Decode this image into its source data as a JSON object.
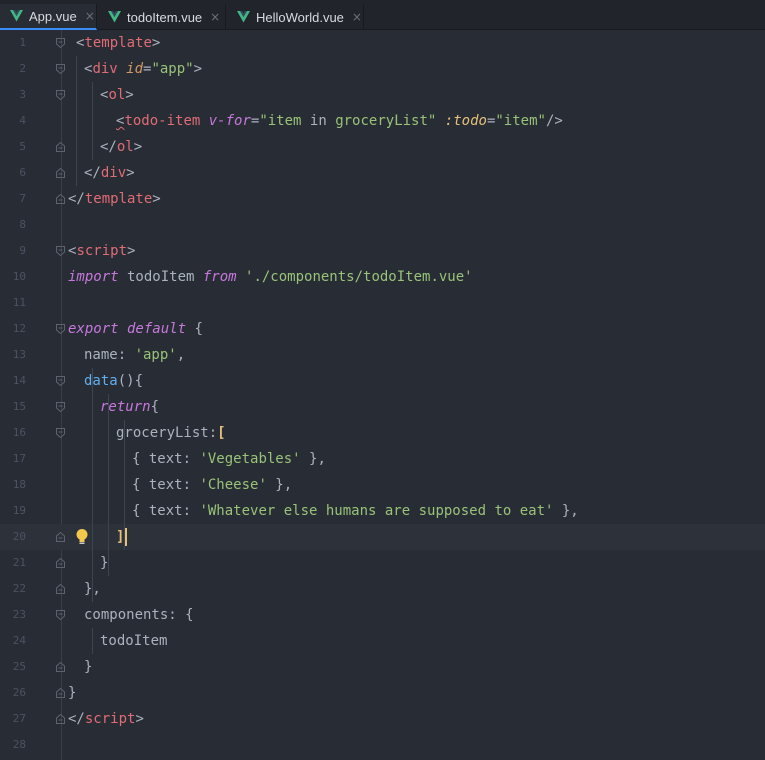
{
  "tabs": [
    {
      "label": "App.vue",
      "active": true
    },
    {
      "label": "todoItem.vue",
      "active": false
    },
    {
      "label": "HelloWorld.vue",
      "active": false
    }
  ],
  "close_glyph": "×",
  "colors": {
    "background": "#282c34",
    "tag": "#e06c75",
    "string": "#98c379",
    "keyword": "#c678dd",
    "attribute": "#d19a66",
    "accent": "#3a8df7",
    "vue_green": "#41b883"
  },
  "lines": [
    {
      "n": "1",
      "tokens": [
        [
          "t-punc",
          "<"
        ],
        [
          "t-tag",
          "template"
        ],
        [
          "t-punc",
          ">"
        ]
      ]
    },
    {
      "n": "2",
      "tokens": [
        [
          "t-punc",
          "<"
        ],
        [
          "t-tag",
          "div "
        ],
        [
          "t-attr",
          "id"
        ],
        [
          "t-punc",
          "="
        ],
        [
          "t-str",
          "\"app\""
        ],
        [
          "t-punc",
          ">"
        ]
      ]
    },
    {
      "n": "3",
      "tokens": [
        [
          "t-punc",
          "<"
        ],
        [
          "t-tag",
          "ol"
        ],
        [
          "t-punc",
          ">"
        ]
      ]
    },
    {
      "n": "4",
      "tokens": [
        [
          "t-punc squiggle",
          "<"
        ],
        [
          "t-tag",
          "todo-item "
        ],
        [
          "t-dir",
          "v-for"
        ],
        [
          "t-punc",
          "="
        ],
        [
          "t-str",
          "\"item "
        ],
        [
          "t-prop",
          "in"
        ],
        [
          "t-str",
          " groceryList\" "
        ],
        [
          "t-bind",
          ":todo"
        ],
        [
          "t-punc",
          "="
        ],
        [
          "t-str",
          "\"item\""
        ],
        [
          "t-punc",
          "/>"
        ]
      ]
    },
    {
      "n": "5",
      "tokens": [
        [
          "t-punc",
          "</"
        ],
        [
          "t-tag",
          "ol"
        ],
        [
          "t-punc",
          ">"
        ]
      ]
    },
    {
      "n": "6",
      "tokens": [
        [
          "t-punc",
          "</"
        ],
        [
          "t-tag",
          "div"
        ],
        [
          "t-punc",
          ">"
        ]
      ]
    },
    {
      "n": "7",
      "tokens": [
        [
          "t-punc",
          "</"
        ],
        [
          "t-tag",
          "template"
        ],
        [
          "t-punc",
          ">"
        ]
      ]
    },
    {
      "n": "8",
      "tokens": []
    },
    {
      "n": "9",
      "tokens": [
        [
          "t-punc",
          "<"
        ],
        [
          "t-tag",
          "script"
        ],
        [
          "t-punc",
          ">"
        ]
      ]
    },
    {
      "n": "10",
      "tokens": [
        [
          "t-kw",
          "import"
        ],
        [
          "t-prop",
          " todoItem "
        ],
        [
          "t-kw",
          "from"
        ],
        [
          "t-str",
          " './components/todoItem.vue'"
        ]
      ]
    },
    {
      "n": "11",
      "tokens": []
    },
    {
      "n": "12",
      "tokens": [
        [
          "t-kw",
          "export default"
        ],
        [
          "t-punc",
          " {"
        ]
      ]
    },
    {
      "n": "13",
      "tokens": [
        [
          "t-prop",
          "name"
        ],
        [
          "t-punc",
          ": "
        ],
        [
          "t-str",
          "'app'"
        ],
        [
          "t-punc",
          ","
        ]
      ]
    },
    {
      "n": "14",
      "tokens": [
        [
          "t-fn",
          "data"
        ],
        [
          "t-punc",
          "(){"
        ]
      ]
    },
    {
      "n": "15",
      "tokens": [
        [
          "t-kw",
          "return"
        ],
        [
          "t-punc",
          "{"
        ]
      ]
    },
    {
      "n": "16",
      "tokens": [
        [
          "t-prop",
          "groceryList"
        ],
        [
          "t-punc",
          ":"
        ],
        [
          "t-bracket-hl",
          "["
        ]
      ]
    },
    {
      "n": "17",
      "tokens": [
        [
          "t-punc",
          "{ "
        ],
        [
          "t-prop",
          "text"
        ],
        [
          "t-punc",
          ": "
        ],
        [
          "t-str",
          "'Vegetables'"
        ],
        [
          "t-punc",
          " },"
        ]
      ]
    },
    {
      "n": "18",
      "tokens": [
        [
          "t-punc",
          "{ "
        ],
        [
          "t-prop",
          "text"
        ],
        [
          "t-punc",
          ": "
        ],
        [
          "t-str",
          "'Cheese'"
        ],
        [
          "t-punc",
          " },"
        ]
      ]
    },
    {
      "n": "19",
      "tokens": [
        [
          "t-punc",
          "{ "
        ],
        [
          "t-prop",
          "text"
        ],
        [
          "t-punc",
          ": "
        ],
        [
          "t-str",
          "'Whatever else humans are supposed to eat'"
        ],
        [
          "t-punc",
          " },"
        ]
      ]
    },
    {
      "n": "20",
      "tokens": [
        [
          "t-bracket-hl",
          "]"
        ]
      ]
    },
    {
      "n": "21",
      "tokens": [
        [
          "t-punc",
          "}"
        ]
      ]
    },
    {
      "n": "22",
      "tokens": [
        [
          "t-punc",
          "},"
        ]
      ]
    },
    {
      "n": "23",
      "tokens": [
        [
          "t-prop",
          "components"
        ],
        [
          "t-punc",
          ": {"
        ]
      ]
    },
    {
      "n": "24",
      "tokens": [
        [
          "t-prop",
          "todoItem"
        ]
      ]
    },
    {
      "n": "25",
      "tokens": [
        [
          "t-punc",
          "}"
        ]
      ]
    },
    {
      "n": "26",
      "tokens": [
        [
          "t-punc",
          "}"
        ]
      ]
    },
    {
      "n": "27",
      "tokens": [
        [
          "t-punc",
          "</"
        ],
        [
          "t-tag",
          "script"
        ],
        [
          "t-punc",
          ">"
        ]
      ]
    },
    {
      "n": "28",
      "tokens": []
    }
  ]
}
